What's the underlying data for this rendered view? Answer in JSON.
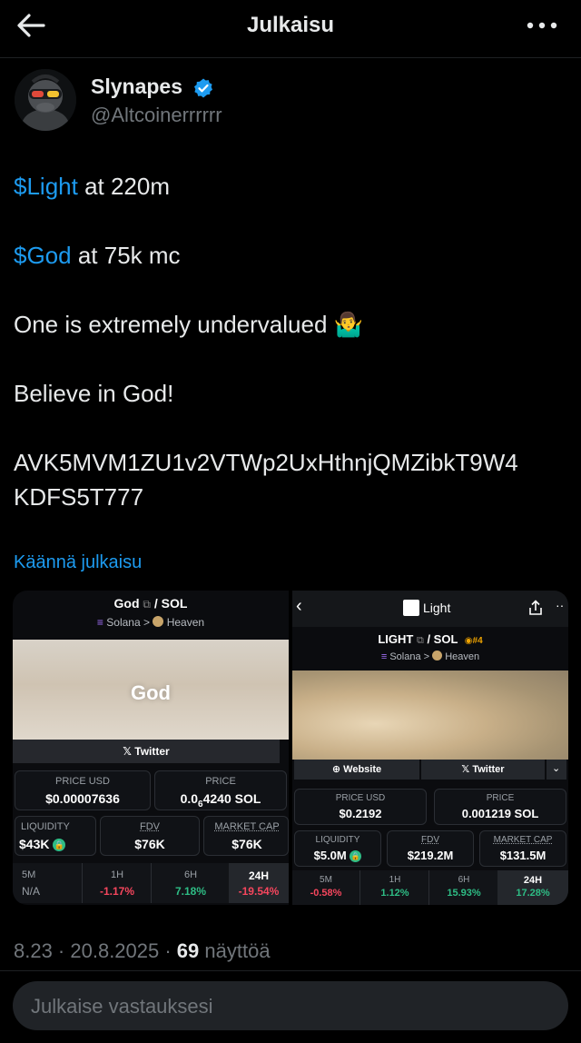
{
  "header": {
    "title": "Julkaisu",
    "back_icon": "arrow-left-icon",
    "more_icon": "more-horizontal-icon"
  },
  "author": {
    "name": "Slynapes",
    "handle": "@Altcoinerrrrrr",
    "verified": true
  },
  "post": {
    "line1_tag": "$Light",
    "line1_rest": " at 220m",
    "line2_tag": "$God",
    "line2_rest": " at 75k mc",
    "line3": "One is extremely undervalued 🤷‍♂️",
    "line4": "Believe in God!",
    "address_line1": "AVK5MVM1ZU1v2VTWp2UxHthnjQMZibkT9W4",
    "address_line2": "KDFS5T777",
    "translate": "Käännä julkaisu"
  },
  "left_card": {
    "pair_token": "God",
    "pair_sep": " / ",
    "pair_quote": "SOL",
    "chain": "Solana",
    "arrow": ">",
    "dex": "Heaven",
    "banner_text": "God",
    "twitter": "Twitter",
    "price_usd_label": "PRICE USD",
    "price_usd": "$0.00007636",
    "price_label": "PRICE",
    "price_a": "0.0",
    "price_sub": "6",
    "price_b": "4240 SOL",
    "liquidity_label": "LIQUIDITY",
    "liquidity": "$43K",
    "fdv_label": "FDV",
    "fdv": "$76K",
    "mcap_label": "MARKET CAP",
    "mcap": "$76K",
    "tf": [
      {
        "label": "5M",
        "value": "N/A"
      },
      {
        "label": "1H",
        "value": "-1.17%"
      },
      {
        "label": "6H",
        "value": "7.18%"
      },
      {
        "label": "24H",
        "value": "-19.54%"
      }
    ]
  },
  "right_card": {
    "nav_title": "Light",
    "pair_token": "LIGHT",
    "pair_sep": " / ",
    "pair_quote": "SOL",
    "rank": "#4",
    "chain": "Solana",
    "arrow": ">",
    "dex": "Heaven",
    "website": "Website",
    "twitter": "Twitter",
    "price_usd_label": "PRICE USD",
    "price_usd": "$0.2192",
    "price_label": "PRICE",
    "price": "0.001219 SOL",
    "liquidity_label": "LIQUIDITY",
    "liquidity": "$5.0M",
    "fdv_label": "FDV",
    "fdv": "$219.2M",
    "mcap_label": "MARKET CAP",
    "mcap": "$131.5M",
    "tf": [
      {
        "label": "5M",
        "value": "-0.58%"
      },
      {
        "label": "1H",
        "value": "1.12%"
      },
      {
        "label": "6H",
        "value": "15.93%"
      },
      {
        "label": "24H",
        "value": "17.28%"
      }
    ]
  },
  "meta": {
    "time": "8.23 · 20.8.2025 · ",
    "views": "69",
    "views_label": " näyttöä"
  },
  "reply": {
    "placeholder": "Julkaise vastauksesi"
  },
  "colors": {
    "accent": "#1d9bf0",
    "negative": "#f6465d",
    "positive": "#2ebd85",
    "background": "#000000"
  }
}
